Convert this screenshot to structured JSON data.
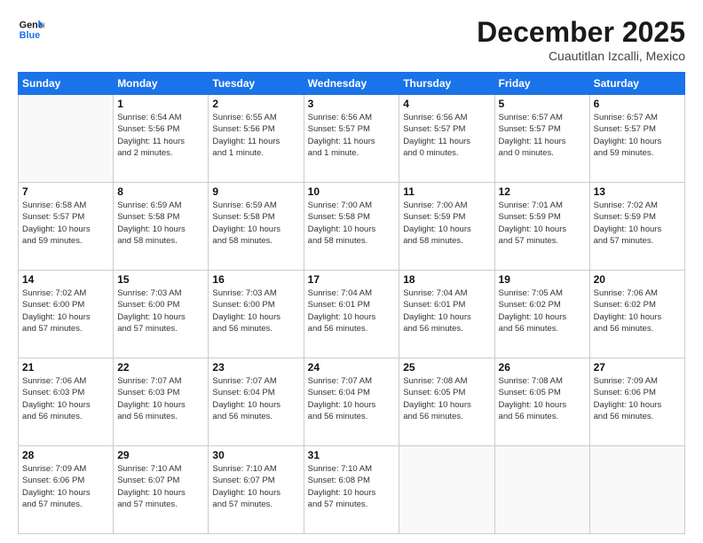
{
  "logo": {
    "line1": "General",
    "line2": "Blue"
  },
  "title": "December 2025",
  "subtitle": "Cuautitlan Izcalli, Mexico",
  "days_of_week": [
    "Sunday",
    "Monday",
    "Tuesday",
    "Wednesday",
    "Thursday",
    "Friday",
    "Saturday"
  ],
  "weeks": [
    [
      {
        "day": "",
        "info": ""
      },
      {
        "day": "1",
        "info": "Sunrise: 6:54 AM\nSunset: 5:56 PM\nDaylight: 11 hours\nand 2 minutes."
      },
      {
        "day": "2",
        "info": "Sunrise: 6:55 AM\nSunset: 5:56 PM\nDaylight: 11 hours\nand 1 minute."
      },
      {
        "day": "3",
        "info": "Sunrise: 6:56 AM\nSunset: 5:57 PM\nDaylight: 11 hours\nand 1 minute."
      },
      {
        "day": "4",
        "info": "Sunrise: 6:56 AM\nSunset: 5:57 PM\nDaylight: 11 hours\nand 0 minutes."
      },
      {
        "day": "5",
        "info": "Sunrise: 6:57 AM\nSunset: 5:57 PM\nDaylight: 11 hours\nand 0 minutes."
      },
      {
        "day": "6",
        "info": "Sunrise: 6:57 AM\nSunset: 5:57 PM\nDaylight: 10 hours\nand 59 minutes."
      }
    ],
    [
      {
        "day": "7",
        "info": "Sunrise: 6:58 AM\nSunset: 5:57 PM\nDaylight: 10 hours\nand 59 minutes."
      },
      {
        "day": "8",
        "info": "Sunrise: 6:59 AM\nSunset: 5:58 PM\nDaylight: 10 hours\nand 58 minutes."
      },
      {
        "day": "9",
        "info": "Sunrise: 6:59 AM\nSunset: 5:58 PM\nDaylight: 10 hours\nand 58 minutes."
      },
      {
        "day": "10",
        "info": "Sunrise: 7:00 AM\nSunset: 5:58 PM\nDaylight: 10 hours\nand 58 minutes."
      },
      {
        "day": "11",
        "info": "Sunrise: 7:00 AM\nSunset: 5:59 PM\nDaylight: 10 hours\nand 58 minutes."
      },
      {
        "day": "12",
        "info": "Sunrise: 7:01 AM\nSunset: 5:59 PM\nDaylight: 10 hours\nand 57 minutes."
      },
      {
        "day": "13",
        "info": "Sunrise: 7:02 AM\nSunset: 5:59 PM\nDaylight: 10 hours\nand 57 minutes."
      }
    ],
    [
      {
        "day": "14",
        "info": "Sunrise: 7:02 AM\nSunset: 6:00 PM\nDaylight: 10 hours\nand 57 minutes."
      },
      {
        "day": "15",
        "info": "Sunrise: 7:03 AM\nSunset: 6:00 PM\nDaylight: 10 hours\nand 57 minutes."
      },
      {
        "day": "16",
        "info": "Sunrise: 7:03 AM\nSunset: 6:00 PM\nDaylight: 10 hours\nand 56 minutes."
      },
      {
        "day": "17",
        "info": "Sunrise: 7:04 AM\nSunset: 6:01 PM\nDaylight: 10 hours\nand 56 minutes."
      },
      {
        "day": "18",
        "info": "Sunrise: 7:04 AM\nSunset: 6:01 PM\nDaylight: 10 hours\nand 56 minutes."
      },
      {
        "day": "19",
        "info": "Sunrise: 7:05 AM\nSunset: 6:02 PM\nDaylight: 10 hours\nand 56 minutes."
      },
      {
        "day": "20",
        "info": "Sunrise: 7:06 AM\nSunset: 6:02 PM\nDaylight: 10 hours\nand 56 minutes."
      }
    ],
    [
      {
        "day": "21",
        "info": "Sunrise: 7:06 AM\nSunset: 6:03 PM\nDaylight: 10 hours\nand 56 minutes."
      },
      {
        "day": "22",
        "info": "Sunrise: 7:07 AM\nSunset: 6:03 PM\nDaylight: 10 hours\nand 56 minutes."
      },
      {
        "day": "23",
        "info": "Sunrise: 7:07 AM\nSunset: 6:04 PM\nDaylight: 10 hours\nand 56 minutes."
      },
      {
        "day": "24",
        "info": "Sunrise: 7:07 AM\nSunset: 6:04 PM\nDaylight: 10 hours\nand 56 minutes."
      },
      {
        "day": "25",
        "info": "Sunrise: 7:08 AM\nSunset: 6:05 PM\nDaylight: 10 hours\nand 56 minutes."
      },
      {
        "day": "26",
        "info": "Sunrise: 7:08 AM\nSunset: 6:05 PM\nDaylight: 10 hours\nand 56 minutes."
      },
      {
        "day": "27",
        "info": "Sunrise: 7:09 AM\nSunset: 6:06 PM\nDaylight: 10 hours\nand 56 minutes."
      }
    ],
    [
      {
        "day": "28",
        "info": "Sunrise: 7:09 AM\nSunset: 6:06 PM\nDaylight: 10 hours\nand 57 minutes."
      },
      {
        "day": "29",
        "info": "Sunrise: 7:10 AM\nSunset: 6:07 PM\nDaylight: 10 hours\nand 57 minutes."
      },
      {
        "day": "30",
        "info": "Sunrise: 7:10 AM\nSunset: 6:07 PM\nDaylight: 10 hours\nand 57 minutes."
      },
      {
        "day": "31",
        "info": "Sunrise: 7:10 AM\nSunset: 6:08 PM\nDaylight: 10 hours\nand 57 minutes."
      },
      {
        "day": "",
        "info": ""
      },
      {
        "day": "",
        "info": ""
      },
      {
        "day": "",
        "info": ""
      }
    ]
  ]
}
